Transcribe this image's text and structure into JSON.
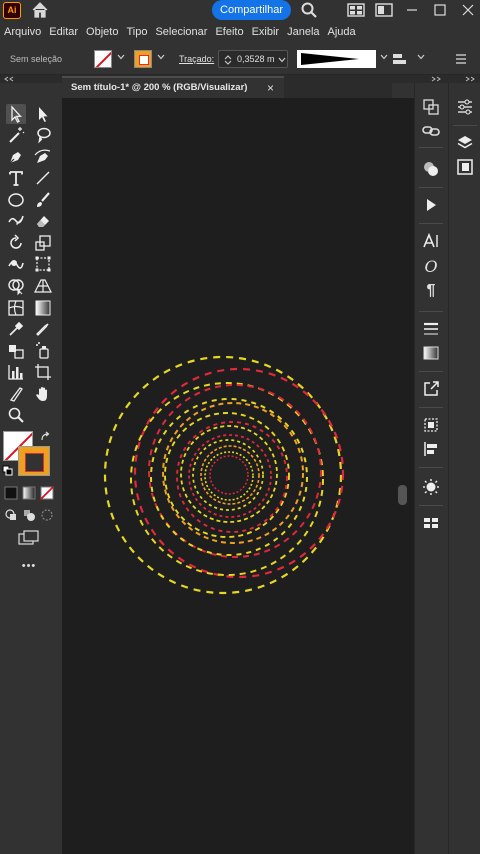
{
  "app": {
    "logo_text": "Ai",
    "share_label": "Compartilhar"
  },
  "menu": [
    "Arquivo",
    "Editar",
    "Objeto",
    "Tipo",
    "Selecionar",
    "Efeito",
    "Exibir",
    "Janela",
    "Ajuda"
  ],
  "control": {
    "selection_label": "Sem seleção",
    "stroke_label": "Traçado:",
    "stroke_weight": "0,3528 m"
  },
  "document_tab": {
    "title": "Sem título-1* @ 200 % (RGB/Visualizar)",
    "close": "×"
  },
  "colors": {
    "accent": "#1473e6",
    "canvas": "#1e1e1e",
    "ring_red": "#e0283c",
    "ring_yellow": "#e6d81e",
    "ring_orange": "#f0a020"
  },
  "icons": {
    "toolbar": [
      "selection-tool-icon",
      "direct-selection-tool-icon",
      "magic-wand-icon",
      "lasso-icon",
      "pen-tool-icon",
      "curvature-tool-icon",
      "type-tool-icon",
      "line-tool-icon",
      "ellipse-tool-icon",
      "paintbrush-icon",
      "shaper-tool-icon",
      "eraser-icon",
      "rotate-tool-icon",
      "scale-tool-icon",
      "warp-tool-icon",
      "free-transform-icon",
      "shape-builder-icon",
      "perspective-grid-icon",
      "mesh-tool-icon",
      "gradient-tool-icon",
      "eyedropper-icon",
      "measure-icon",
      "blend-tool-icon",
      "symbol-sprayer-icon",
      "column-graph-icon",
      "artboard-tool-icon",
      "slice-tool-icon",
      "hand-tool-icon",
      "zoom-tool-icon"
    ],
    "more": "•••"
  }
}
